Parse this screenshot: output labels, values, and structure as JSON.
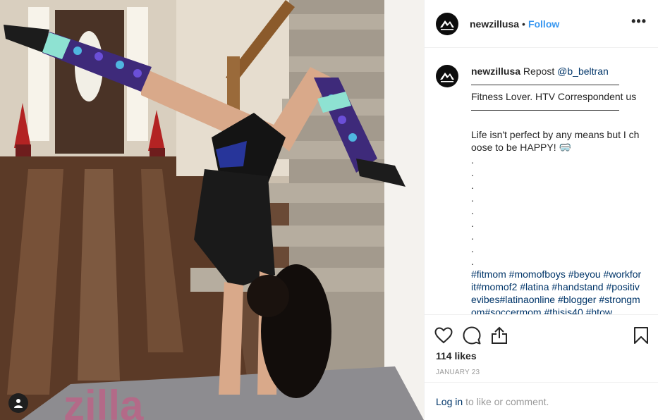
{
  "post": {
    "username": "newzillusa",
    "follow_label": "Follow",
    "separator": "•",
    "more_label": "•••"
  },
  "caption": {
    "username": "newzillusa",
    "repost_word": "Repost",
    "mention": "@b_beltran",
    "rule_1": "———————————————",
    "bio": "Fitness Lover. HTV Correspondent us",
    "rule_2": "———————————————",
    "text_1": "Life isn't perfect by any means but I choose to be HAPPY! 🥽",
    "dots": [
      ".",
      ".",
      ".",
      ".",
      ".",
      ".",
      ".",
      ".",
      "."
    ],
    "hashtags": "#fitmom #momofboys #beyou #workforit#momof2 #latina #handstand #positivevibes#latinaonline #blogger #strongmom#soccermom #thisis40 #htow"
  },
  "actions": {
    "likes": "114 likes",
    "date": "JANUARY 23",
    "icons": [
      "heart-icon",
      "comment-icon",
      "share-icon",
      "bookmark-icon"
    ]
  },
  "login": {
    "link_label": "Log in",
    "suffix": "to like or comment."
  },
  "colors": {
    "link_blue": "#3897f0",
    "hashtag_navy": "#003569",
    "muted_gray": "#999999",
    "text": "#262626"
  }
}
